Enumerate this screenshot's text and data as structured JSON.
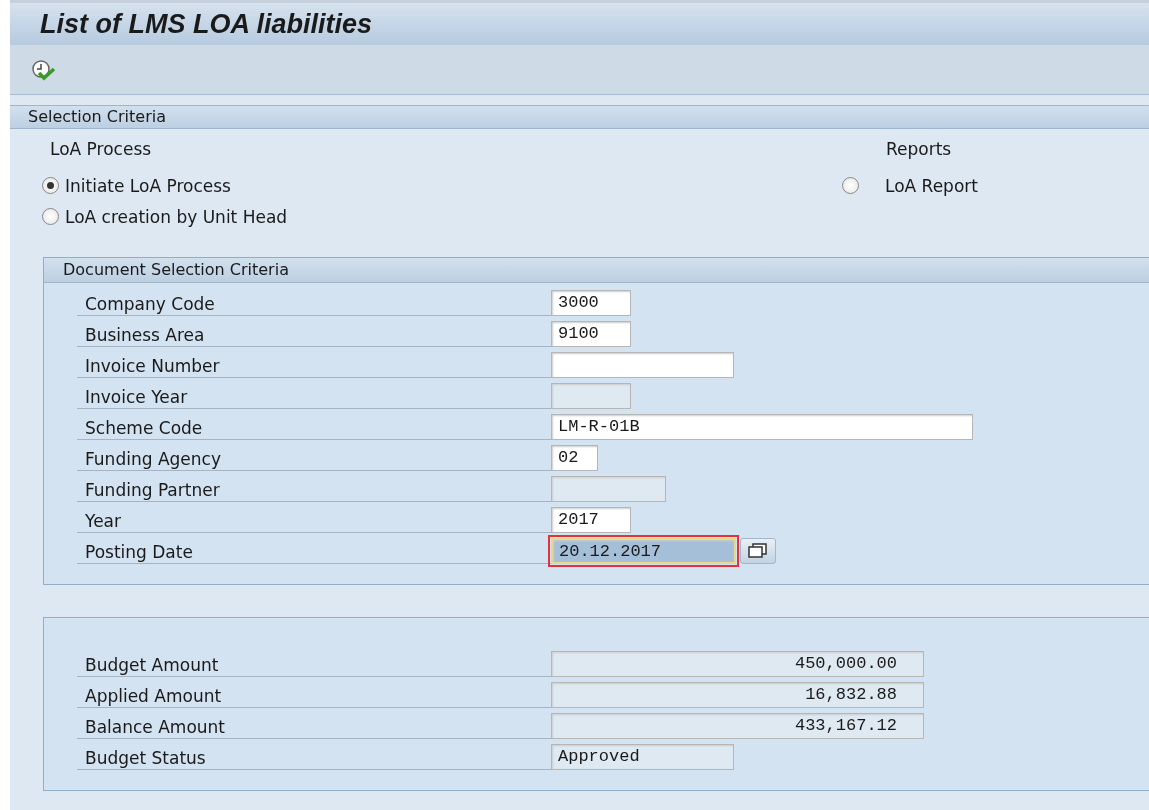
{
  "window": {
    "title": "List of LMS LOA liabilities"
  },
  "selection_criteria": {
    "title": "Selection Criteria",
    "loa_process": {
      "title": "LoA Process",
      "options": [
        {
          "label": "Initiate LoA Process",
          "selected": true
        },
        {
          "label": "LoA creation by Unit Head",
          "selected": false
        }
      ]
    },
    "reports": {
      "title": "Reports",
      "options": [
        {
          "label": "LoA Report",
          "selected": false
        }
      ]
    }
  },
  "document_selection": {
    "title": "Document Selection Criteria",
    "fields": [
      {
        "label": "Company Code",
        "value": "3000",
        "editable": true,
        "focused": false
      },
      {
        "label": "Business Area",
        "value": "9100",
        "editable": true,
        "focused": false
      },
      {
        "label": "Invoice Number",
        "editable": true,
        "focused": false
      },
      {
        "label": "Invoice Year",
        "editable": false,
        "focused": false
      },
      {
        "label": "Scheme Code",
        "value": "LM-R-01B",
        "editable": true,
        "focused": false
      },
      {
        "label": "Funding Agency",
        "value": "02",
        "editable": true,
        "focused": false
      },
      {
        "label": "Funding Partner",
        "editable": false,
        "focused": false
      },
      {
        "label": "Year",
        "value": "2017",
        "editable": true,
        "focused": false
      },
      {
        "label": "Posting Date",
        "value": "20.12.2017",
        "editable": true,
        "focused": true
      }
    ]
  },
  "budget": {
    "fields": [
      {
        "label": "Budget Amount",
        "value": "450,000.00",
        "kind": "amount"
      },
      {
        "label": "Applied Amount",
        "value": "16,832.88",
        "kind": "amount"
      },
      {
        "label": "Balance Amount",
        "value": "433,167.12",
        "kind": "amount"
      },
      {
        "label": "Budget Status",
        "value": "Approved",
        "kind": "text"
      }
    ]
  }
}
